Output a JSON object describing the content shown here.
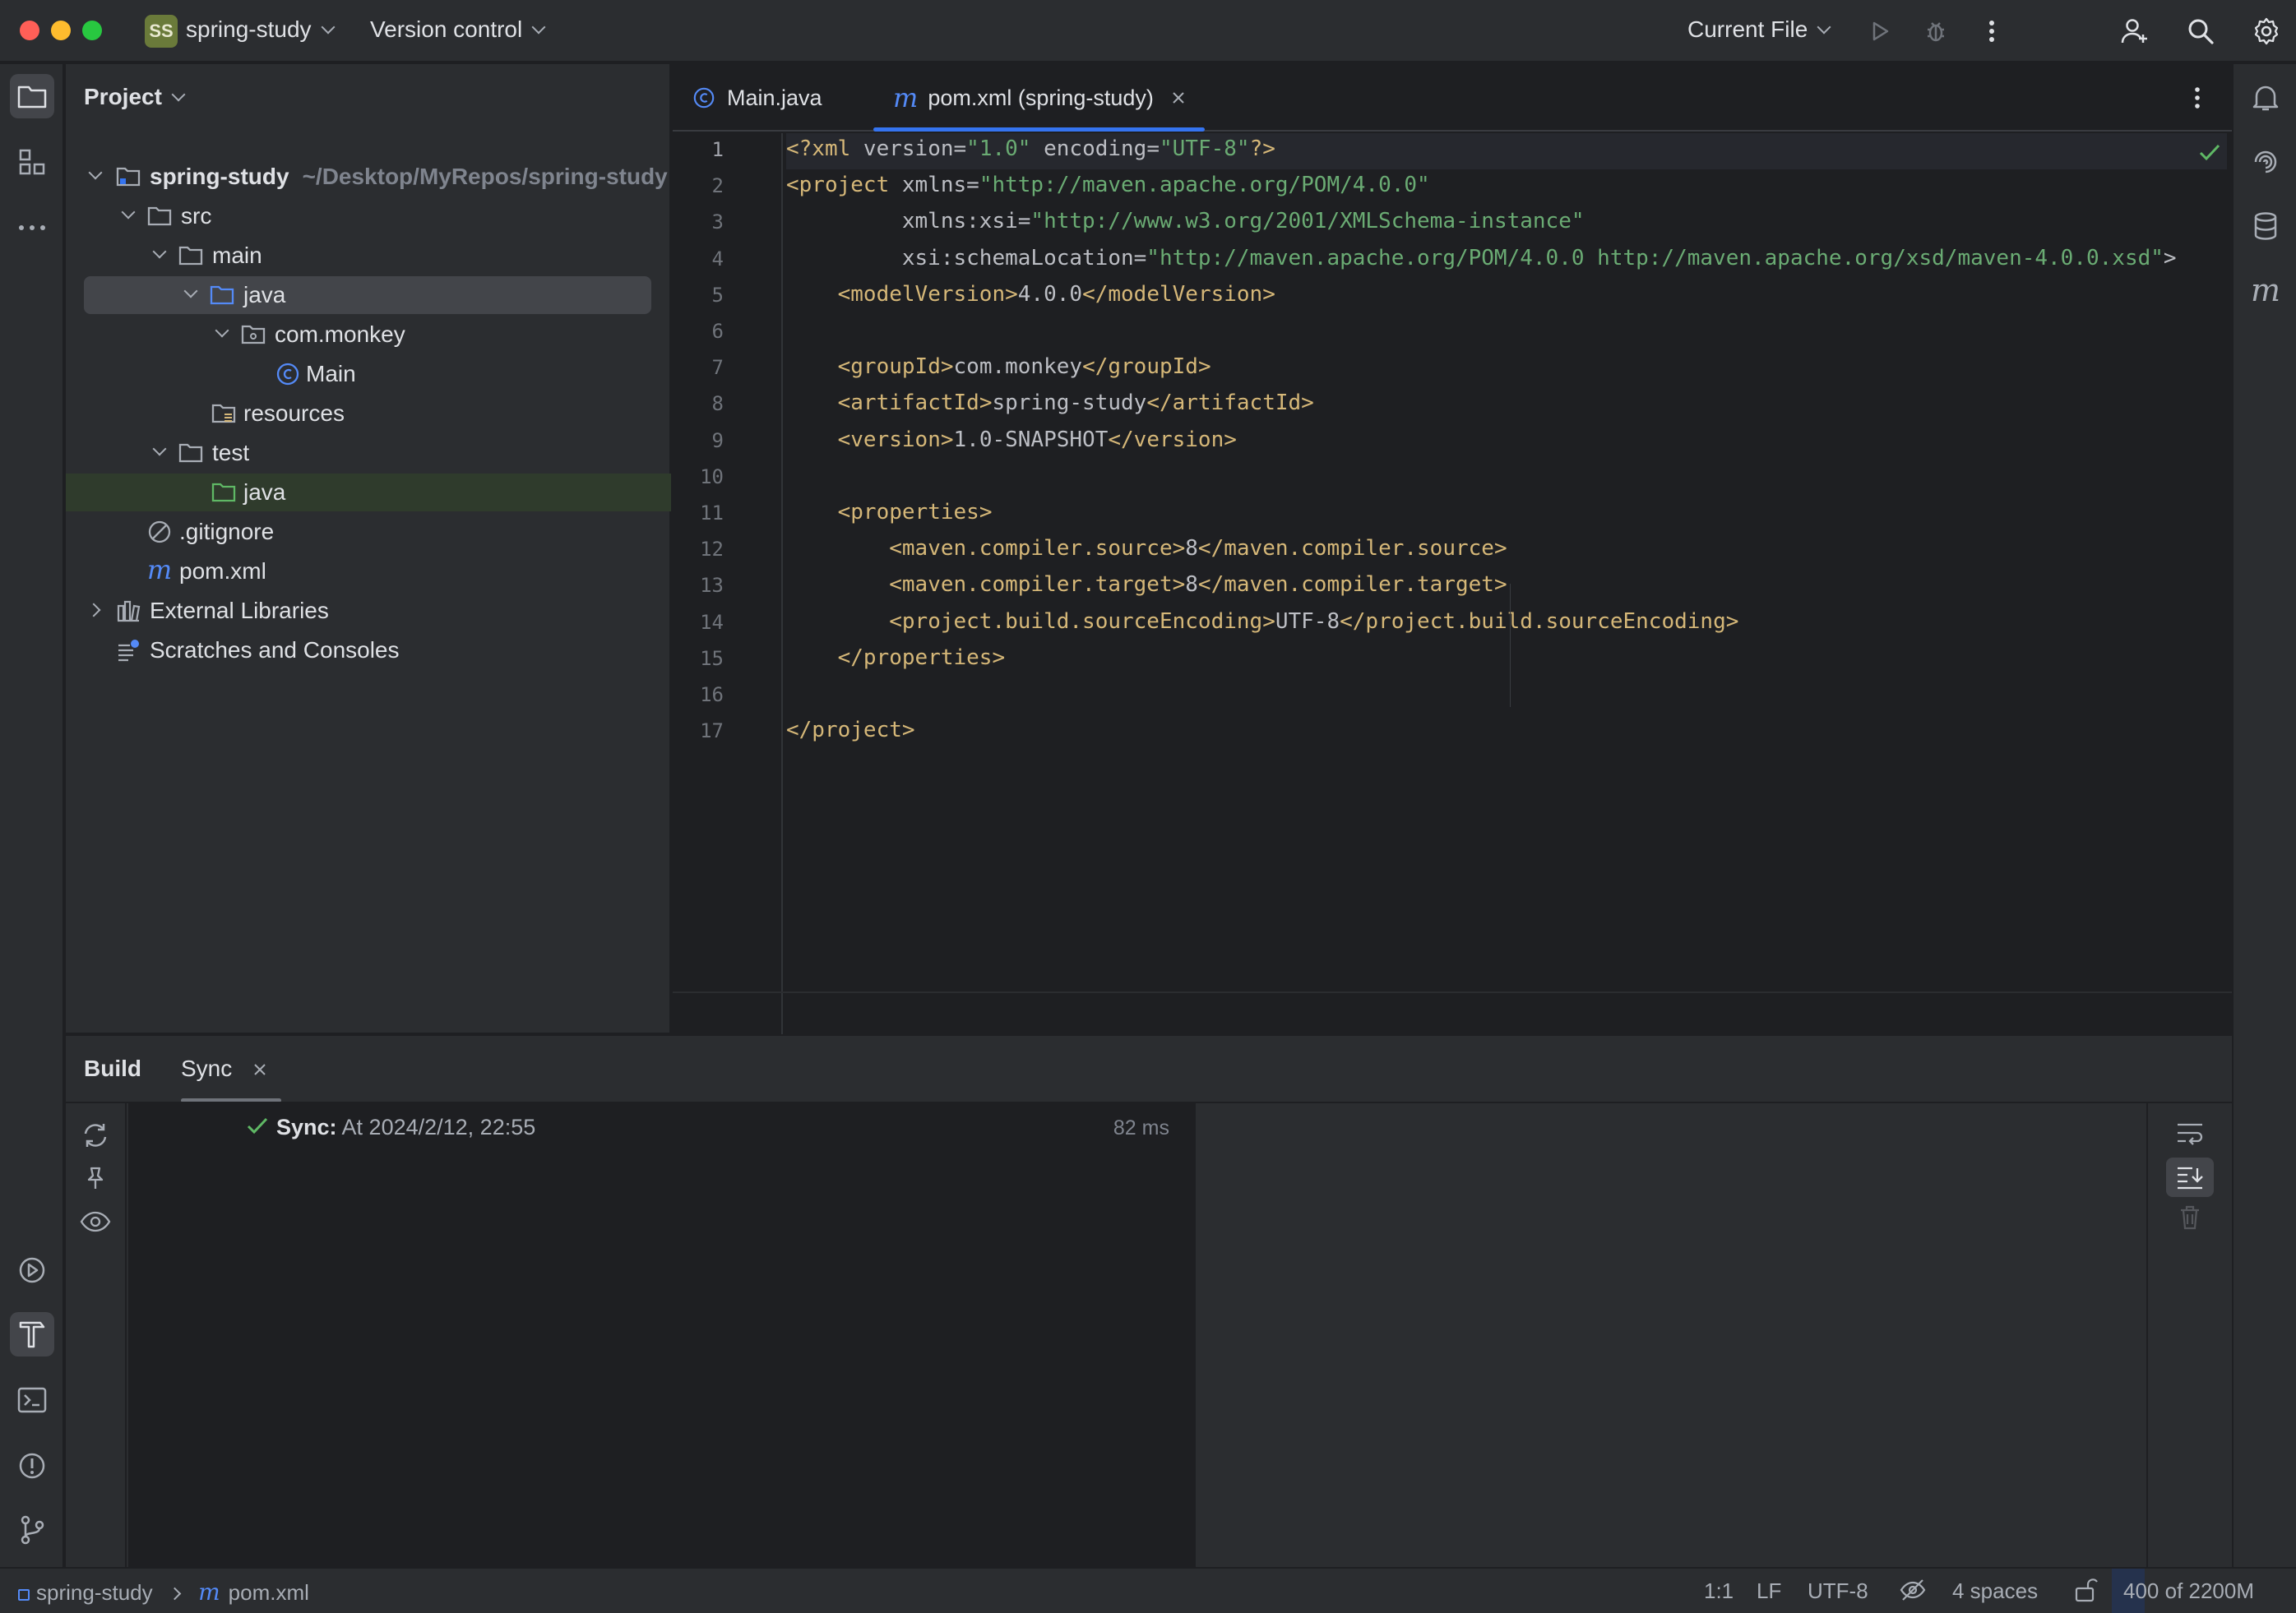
{
  "titlebar": {
    "project_badge": "SS",
    "project_name": "spring-study",
    "vcs": "Version control",
    "run_config": "Current File"
  },
  "project_panel": {
    "title": "Project",
    "tree": [
      {
        "label": "spring-study",
        "path": "~/Desktop/MyRepos/spring-study",
        "icon": "module-folder-icon"
      },
      {
        "label": "src",
        "icon": "folder-icon"
      },
      {
        "label": "main",
        "icon": "folder-icon"
      },
      {
        "label": "java",
        "icon": "source-folder-icon"
      },
      {
        "label": "com.monkey",
        "icon": "package-icon"
      },
      {
        "label": "Main",
        "icon": "class-icon"
      },
      {
        "label": "resources",
        "icon": "resources-folder-icon"
      },
      {
        "label": "test",
        "icon": "folder-icon"
      },
      {
        "label": "java",
        "icon": "test-folder-icon"
      },
      {
        "label": ".gitignore",
        "icon": "ignore-file-icon"
      },
      {
        "label": "pom.xml",
        "icon": "maven-icon"
      },
      {
        "label": "External Libraries",
        "icon": "libraries-icon"
      },
      {
        "label": "Scratches and Consoles",
        "icon": "scratches-icon"
      }
    ]
  },
  "editor": {
    "tabs": [
      {
        "label": "Main.java",
        "icon": "class-icon"
      },
      {
        "label": "pom.xml (spring-study)",
        "icon": "maven-icon"
      }
    ],
    "line_numbers": [
      "1",
      "2",
      "3",
      "4",
      "5",
      "6",
      "7",
      "8",
      "9",
      "10",
      "11",
      "12",
      "13",
      "14",
      "15",
      "16",
      "17"
    ],
    "lines": [
      "<?xml version=\"1.0\" encoding=\"UTF-8\"?>",
      "<project xmlns=\"http://maven.apache.org/POM/4.0.0\"",
      "         xmlns:xsi=\"http://www.w3.org/2001/XMLSchema-instance\"",
      "         xsi:schemaLocation=\"http://maven.apache.org/POM/4.0.0 http://maven.apache.org/xsd/maven-4.0.0.xsd\">",
      "    <modelVersion>4.0.0</modelVersion>",
      "",
      "    <groupId>com.monkey</groupId>",
      "    <artifactId>spring-study</artifactId>",
      "    <version>1.0-SNAPSHOT</version>",
      "",
      "    <properties>",
      "        <maven.compiler.source>8</maven.compiler.source>",
      "        <maven.compiler.target>8</maven.compiler.target>",
      "        <project.build.sourceEncoding>UTF-8</project.build.sourceEncoding>",
      "    </properties>",
      "",
      "</project>"
    ]
  },
  "build": {
    "title": "Build",
    "tab": "Sync",
    "entry_label": "Sync:",
    "entry_time": "At 2024/2/12, 22:55",
    "entry_duration": "82 ms"
  },
  "statusbar": {
    "breadcrumb_project": "spring-study",
    "breadcrumb_file": "pom.xml",
    "position": "1:1",
    "line_sep": "LF",
    "encoding": "UTF-8",
    "indent": "4 spaces",
    "memory": "400 of 2200M",
    "memory_fraction": 0.18
  },
  "colors": {
    "accent": "#3574f0",
    "tag": "#d5b778",
    "string": "#6aab73",
    "ok": "#5fb865"
  }
}
